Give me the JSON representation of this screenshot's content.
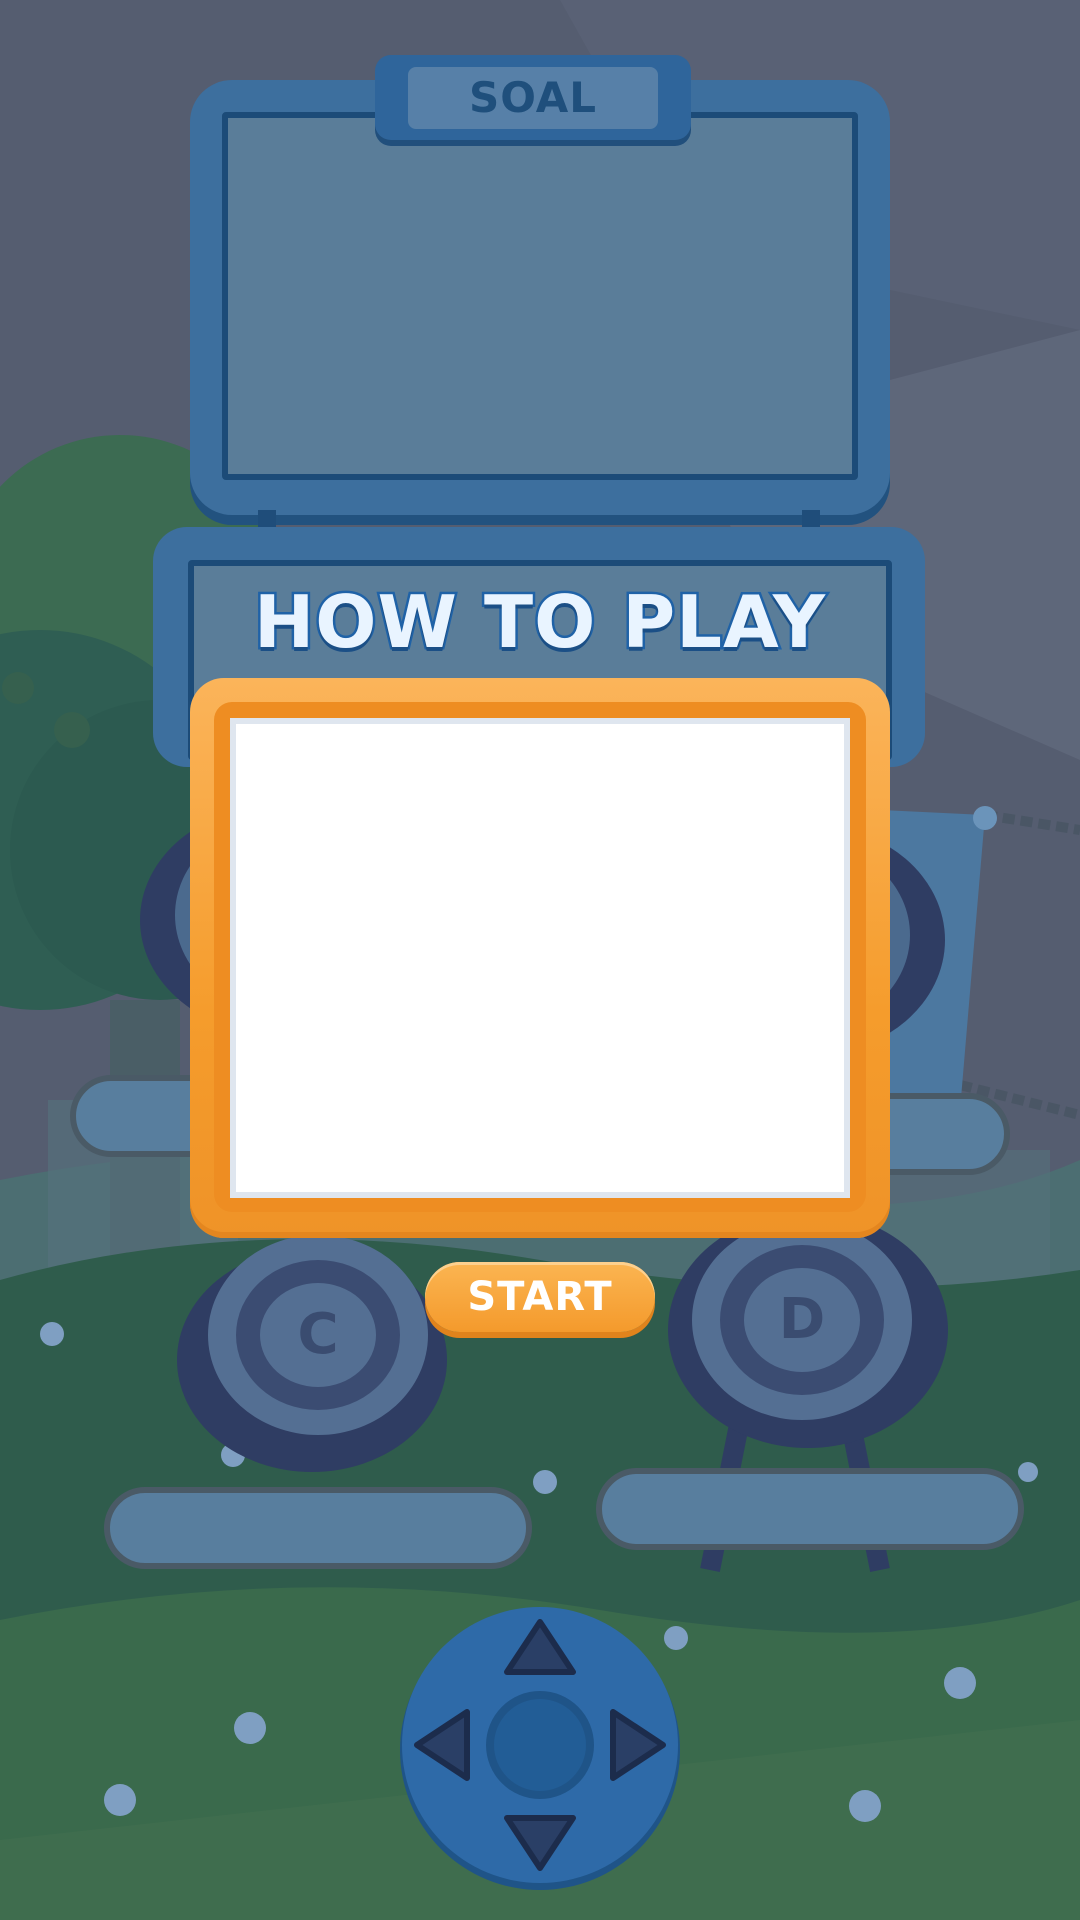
{
  "board": {
    "tab_label": "SOAL"
  },
  "how_to_play": {
    "title": "HOW TO PLAY"
  },
  "start_button": {
    "label": "START"
  },
  "targets": [
    {
      "letter": "C"
    },
    {
      "letter": "D"
    }
  ],
  "dpad": {
    "buttons": [
      "up-arrow-icon",
      "down-arrow-icon",
      "left-arrow-icon",
      "right-arrow-icon",
      "center-button"
    ]
  },
  "colors": {
    "board_blue": "#3d6f9e",
    "panel_fill": "#5a7d99",
    "accent_orange": "#f59c2c",
    "grass_green": "#2f5a46",
    "sky": "#555d70"
  }
}
